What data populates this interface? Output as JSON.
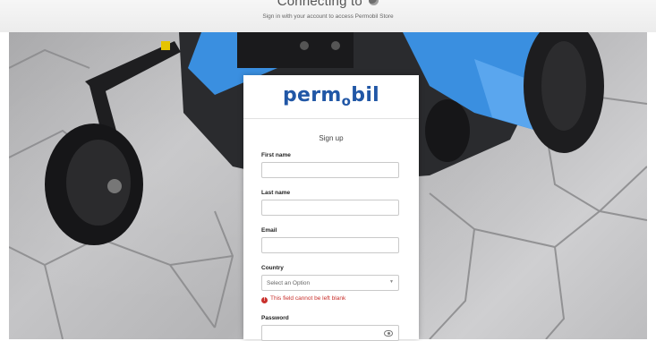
{
  "header": {
    "title": "Connecting to",
    "subtitle": "Sign in with your account to access Permobil Store",
    "icon": "globe-icon"
  },
  "card": {
    "logo": {
      "prefix": "perm",
      "o": "o",
      "suffix": "bil",
      "color": "#2157a6"
    },
    "title": "Sign up",
    "fields": {
      "first_name": {
        "label": "First name",
        "value": ""
      },
      "last_name": {
        "label": "Last name",
        "value": ""
      },
      "email": {
        "label": "Email",
        "value": ""
      },
      "country": {
        "label": "Country",
        "value": "Select an Option"
      },
      "password": {
        "label": "Password",
        "value": ""
      }
    },
    "country_error": "This field cannot be left blank"
  },
  "colors": {
    "error": "#c9302c",
    "brand": "#2157a6",
    "chair_blue": "#3a8fe0"
  }
}
